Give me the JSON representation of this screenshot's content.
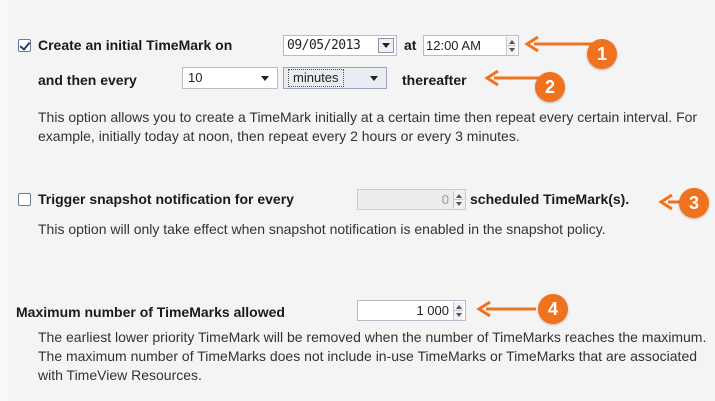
{
  "section1": {
    "create_label": "Create an initial TimeMark on",
    "date_value": "09/05/2013",
    "at_label": "at",
    "time_value": "12:00 AM",
    "then_label": "and then every",
    "interval_value": "10",
    "unit_value": "minutes",
    "thereafter_label": "thereafter",
    "description": "This option allows you to create a TimeMark initially at a certain time then repeat every certain interval. For example, initially today at noon, then repeat every 2 hours or every 3 minutes."
  },
  "section2": {
    "trigger_label": "Trigger snapshot notification for every",
    "count_value": "0",
    "scheduled_label": "scheduled TimeMark(s).",
    "description": "This option will only take effect when snapshot notification is enabled in the snapshot policy."
  },
  "section3": {
    "max_label": "Maximum number of TimeMarks allowed",
    "max_value": "1 000",
    "description": "The earliest lower priority TimeMark will be removed when the number of TimeMarks reaches the maximum. The maximum number of TimeMarks does not include in-use TimeMarks or TimeMarks that are associated with TimeView Resources."
  },
  "callouts": {
    "badge_1": "1",
    "badge_2": "2",
    "badge_3": "3",
    "badge_4": "4",
    "color": "#f0721f"
  }
}
